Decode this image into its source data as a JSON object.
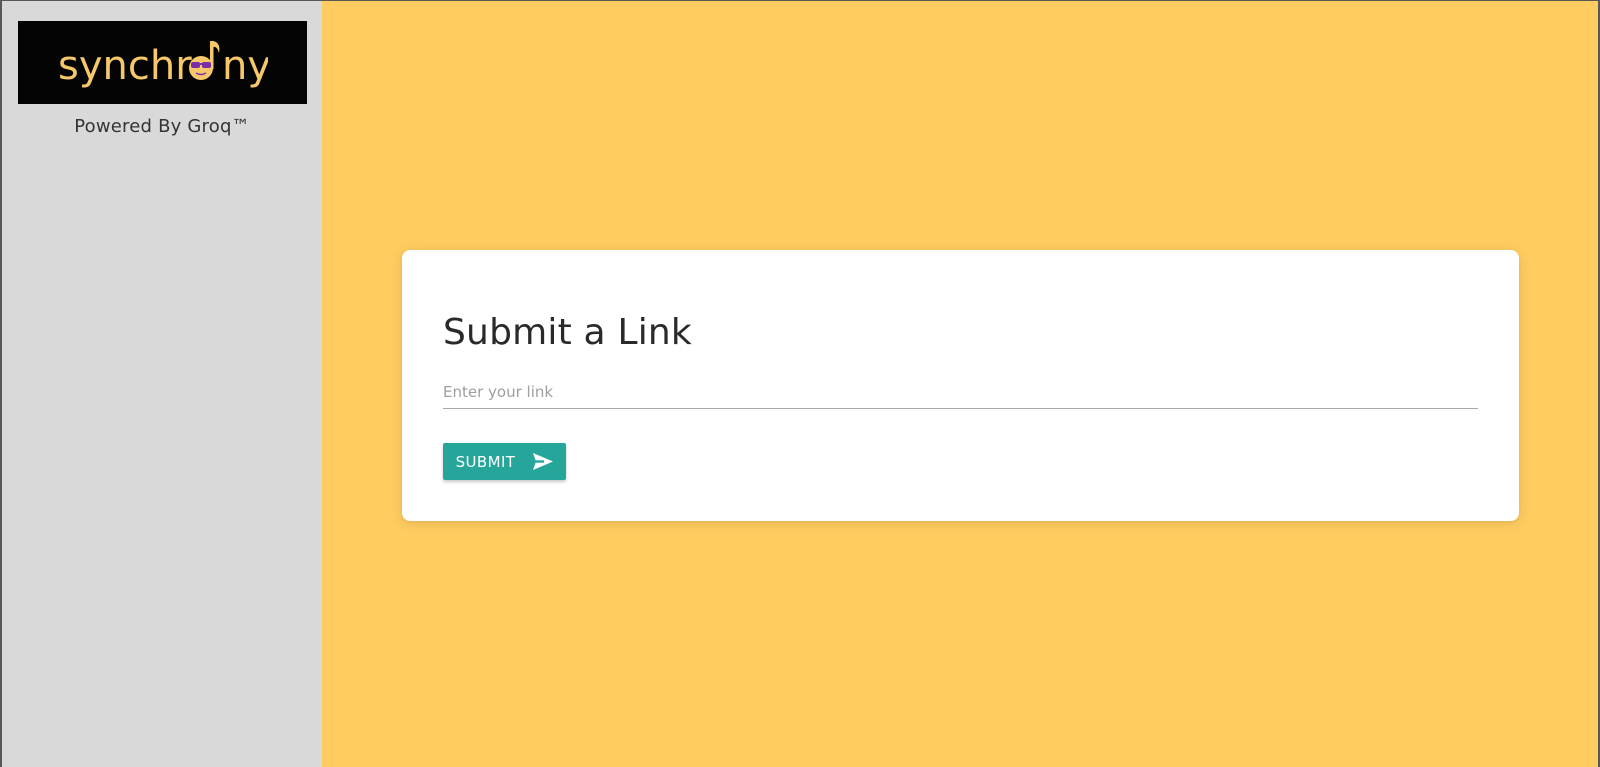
{
  "sidebar": {
    "logo_text": "synchrony",
    "logo_text_before": "synchr",
    "logo_text_after": "ny",
    "powered_by": "Powered By Groq™"
  },
  "form": {
    "title": "Submit a Link",
    "input_placeholder": "Enter your link",
    "input_value": "",
    "submit_label": "SUBMIT",
    "submit_icon": "send-icon"
  },
  "colors": {
    "sidebar_bg": "#d9d9d9",
    "main_bg": "#ffcc60",
    "logo_bg": "#040404",
    "logo_text": "#f6c86a",
    "logo_accent": "#7b2fa6",
    "button_bg": "#26a69a"
  }
}
